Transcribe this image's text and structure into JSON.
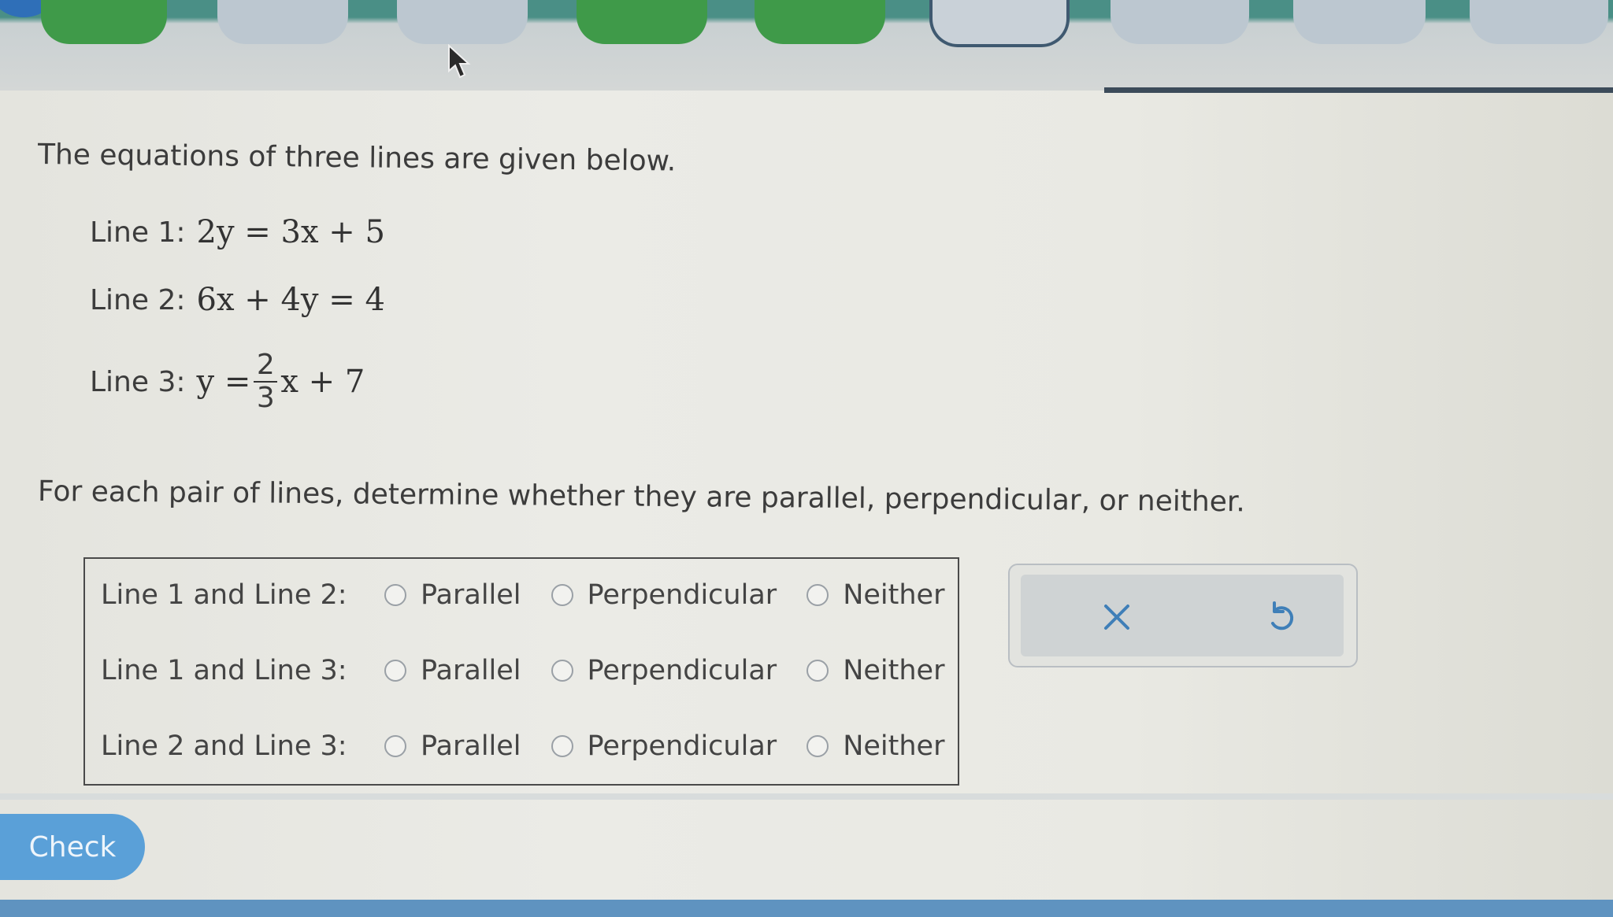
{
  "progress": {
    "steps": [
      {
        "state": "green"
      },
      {
        "state": "grey"
      },
      {
        "state": "grey"
      },
      {
        "state": "green"
      },
      {
        "state": "green"
      },
      {
        "state": "current"
      },
      {
        "state": "grey"
      },
      {
        "state": "grey"
      },
      {
        "state": "grey"
      }
    ]
  },
  "question": {
    "intro": "The equations of three lines are given below.",
    "lines": [
      {
        "label": "Line 1:",
        "equation": "2y = 3x + 5"
      },
      {
        "label": "Line 2:",
        "equation": "6x + 4y = 4"
      },
      {
        "label": "Line 3:",
        "lhs": "y =",
        "numerator": "2",
        "denominator": "3",
        "rhs": "x + 7"
      }
    ],
    "instructions": "For each pair of lines, determine whether they are parallel, perpendicular, or neither."
  },
  "answers": {
    "rows": [
      {
        "label": "Line 1 and Line 2:",
        "options": [
          "Parallel",
          "Perpendicular",
          "Neither"
        ]
      },
      {
        "label": "Line 1 and Line 3:",
        "options": [
          "Parallel",
          "Perpendicular",
          "Neither"
        ]
      },
      {
        "label": "Line 2 and Line 3:",
        "options": [
          "Parallel",
          "Perpendicular",
          "Neither"
        ]
      }
    ]
  },
  "tools": {
    "clear_icon": "close-icon",
    "undo_icon": "undo-icon"
  },
  "footer": {
    "check_label": "Check"
  },
  "colors": {
    "progress_green": "#3f9a49",
    "progress_grey": "#bcc7d0",
    "check_button": "#5aa0d8",
    "tool_icon": "#3f7fb8"
  }
}
